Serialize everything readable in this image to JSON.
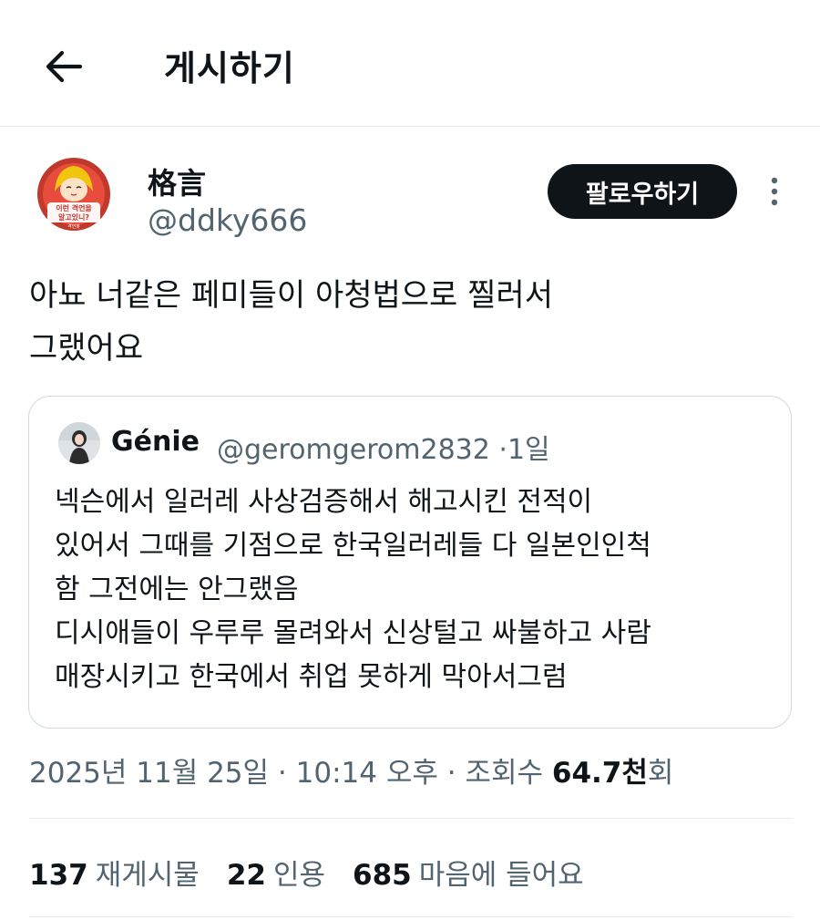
{
  "header": {
    "back_icon": "arrow-left-icon",
    "title": "게시하기"
  },
  "author": {
    "display_name": "格言",
    "handle": "@ddky666",
    "avatar_text_line1": "이런 격언을",
    "avatar_text_line2": "알고있니?",
    "avatar_text_line3": "격언봇",
    "follow_label": "팔로우하기",
    "more_icon": "more-vertical-icon"
  },
  "tweet": {
    "text": "아뇨 너같은 페미들이 아청법으로 찔러서\n그랬어요"
  },
  "quote": {
    "name": "Génie",
    "handle": "@geromgerom2832",
    "separator": "·",
    "age": "1일",
    "text": "넥슨에서 일러레 사상검증해서 해고시킨 전적이\n있어서 그때를 기점으로 한국일러레들 다 일본인인척\n함 그전에는 안그랬음\n디시애들이 우루루 몰려와서 신상털고 싸불하고 사람\n매장시키고 한국에서 취업 못하게 막아서그럼"
  },
  "meta": {
    "date": "2025년 11월 25일",
    "sep1": "·",
    "time": "10:14 오후",
    "sep2": "·",
    "views_label": "조회수",
    "views_count": "64.7천",
    "views_suffix": "회"
  },
  "stats": [
    {
      "count": "137",
      "label": "재게시물"
    },
    {
      "count": "22",
      "label": "인용"
    },
    {
      "count": "685",
      "label": "마음에 들어요"
    }
  ],
  "colors": {
    "text_primary": "#0f1419",
    "text_secondary": "#536471",
    "border": "#cfd9de",
    "divider": "#e6e8ea",
    "follow_bg": "#0f1419",
    "follow_text": "#ffffff"
  }
}
